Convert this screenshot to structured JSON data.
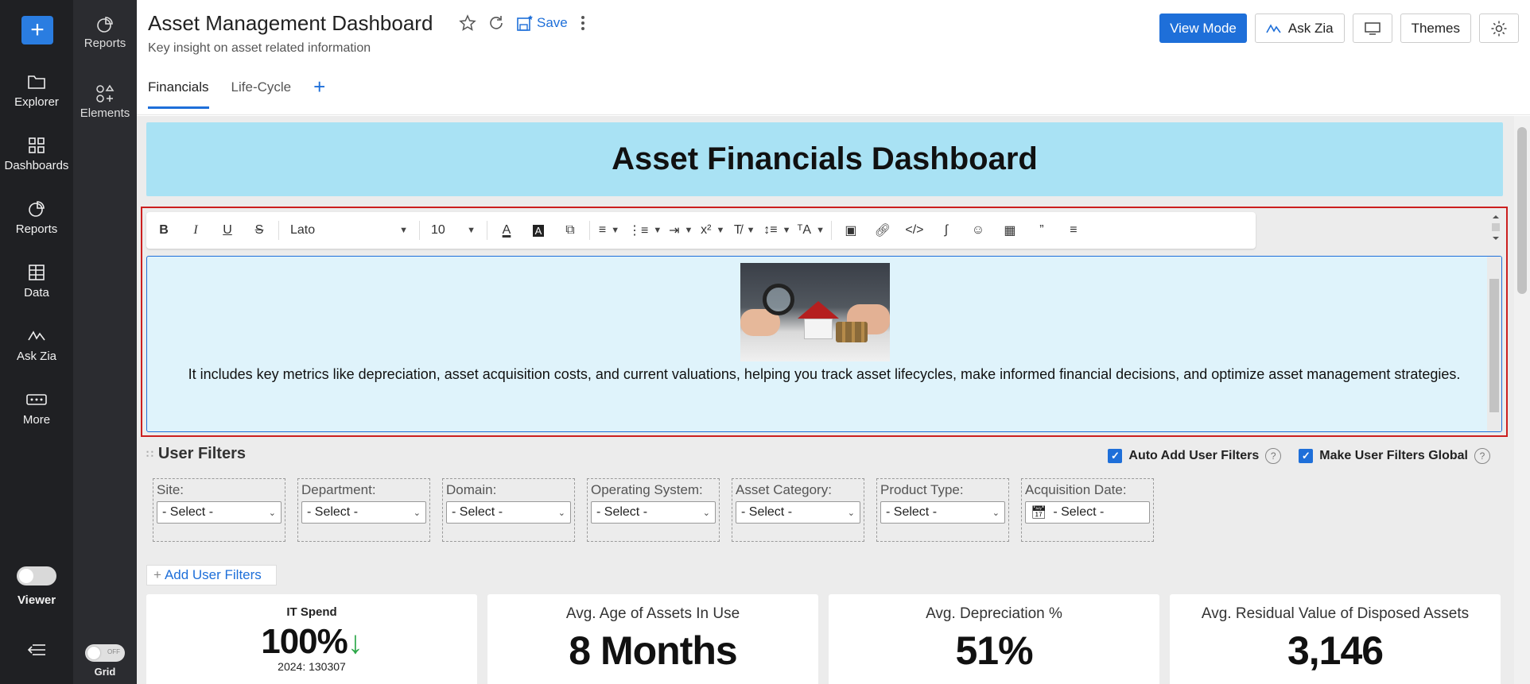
{
  "rail": {
    "items": [
      {
        "label": "Explorer"
      },
      {
        "label": "Dashboards"
      },
      {
        "label": "Reports"
      },
      {
        "label": "Data"
      },
      {
        "label": "Ask Zia"
      },
      {
        "label": "More"
      }
    ],
    "viewer_label": "Viewer"
  },
  "rail2": {
    "items": [
      {
        "label": "Reports"
      },
      {
        "label": "Elements"
      }
    ],
    "grid_label": "Grid",
    "grid_toggle_text": "OFF"
  },
  "header": {
    "title": "Asset Management Dashboard",
    "subtitle": "Key insight on asset related information",
    "save_label": "Save",
    "view_mode_label": "View Mode",
    "ask_zia_label": "Ask Zia",
    "themes_label": "Themes"
  },
  "tabs": [
    {
      "label": "Financials",
      "active": true
    },
    {
      "label": "Life-Cycle",
      "active": false
    }
  ],
  "banner": {
    "title": "Asset Financials Dashboard"
  },
  "toolbar": {
    "font": "Lato",
    "size": "10"
  },
  "editor": {
    "text": "It includes key metrics like depreciation, asset acquisition costs, and current valuations, helping you track asset lifecycles, make informed financial decisions, and optimize asset management strategies."
  },
  "user_filters": {
    "title": "User Filters",
    "auto_add_label": "Auto Add User Filters",
    "auto_add_checked": true,
    "global_label": "Make User Filters Global",
    "global_checked": true,
    "add_label": "Add User Filters",
    "filters": [
      {
        "label": "Site:",
        "value": "- Select -"
      },
      {
        "label": "Department:",
        "value": "- Select -"
      },
      {
        "label": "Domain:",
        "value": "- Select -"
      },
      {
        "label": "Operating System:",
        "value": "- Select -"
      },
      {
        "label": "Asset Category:",
        "value": "- Select -"
      },
      {
        "label": "Product Type:",
        "value": "- Select -"
      },
      {
        "label": "Acquisition Date:",
        "value": "- Select -"
      }
    ]
  },
  "kpis": [
    {
      "title": "IT Spend",
      "value": "100%",
      "sub": "2024: 130307",
      "trend": "down",
      "trend_color": "#2ea84a"
    },
    {
      "title": "Avg. Age of Assets In Use",
      "value": "8 Months"
    },
    {
      "title": "Avg. Depreciation %",
      "value": "51%"
    },
    {
      "title": "Avg. Residual Value of Disposed Assets",
      "value": "3,146"
    }
  ],
  "colors": {
    "accent": "#1e6fd9",
    "banner": "#a9e2f4",
    "editor_border": "#cc1f1f"
  }
}
